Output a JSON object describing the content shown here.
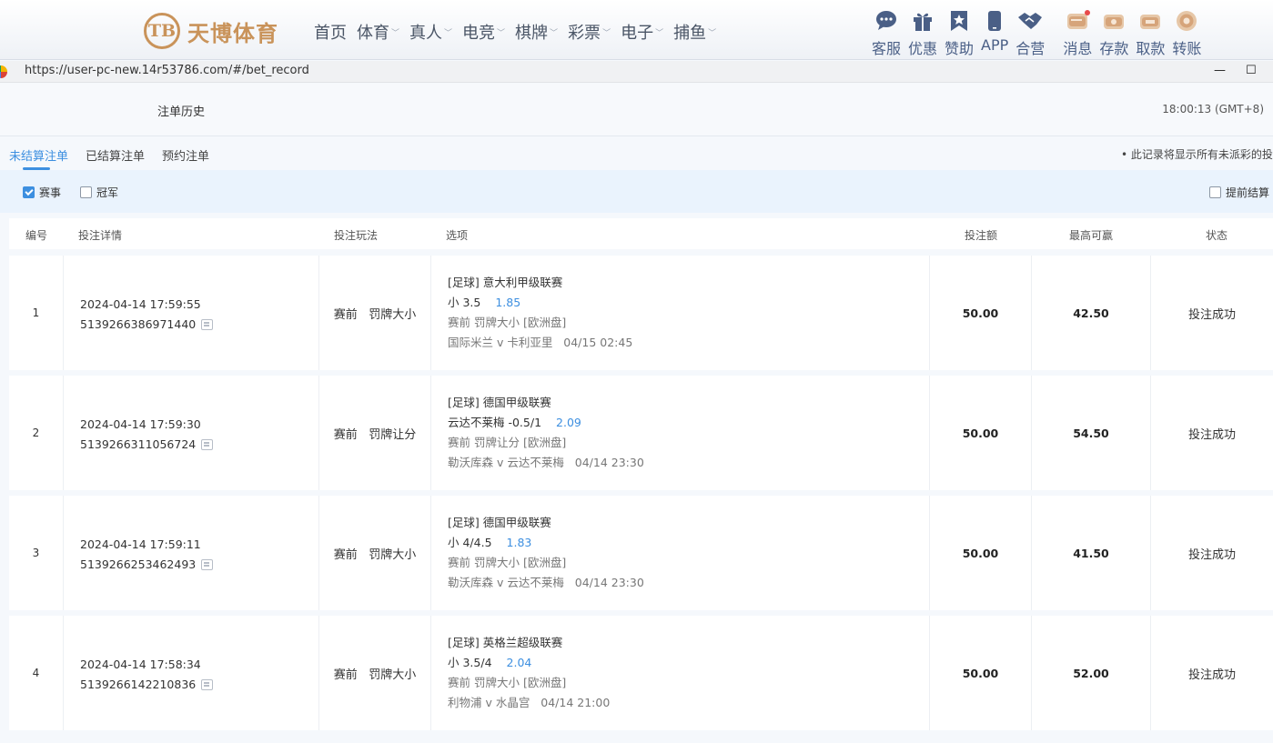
{
  "brand": {
    "logo_mark": "TB",
    "name": "天博体育"
  },
  "main_nav": [
    {
      "label": "首页",
      "has_dropdown": false
    },
    {
      "label": "体育",
      "has_dropdown": true
    },
    {
      "label": "真人",
      "has_dropdown": true
    },
    {
      "label": "电竞",
      "has_dropdown": true
    },
    {
      "label": "棋牌",
      "has_dropdown": true
    },
    {
      "label": "彩票",
      "has_dropdown": true
    },
    {
      "label": "电子",
      "has_dropdown": true
    },
    {
      "label": "捕鱼",
      "has_dropdown": true
    }
  ],
  "right_nav": [
    {
      "label": "客服",
      "icon": "chat-bubble-icon"
    },
    {
      "label": "优惠",
      "icon": "gift-icon"
    },
    {
      "label": "赞助",
      "icon": "bookmark-star-icon"
    },
    {
      "label": "APP",
      "icon": "phone-icon"
    },
    {
      "label": "合营",
      "icon": "handshake-icon"
    },
    {
      "label": "消息",
      "icon": "message-icon",
      "badge": true
    },
    {
      "label": "存款",
      "icon": "deposit-icon"
    },
    {
      "label": "取款",
      "icon": "withdraw-icon"
    },
    {
      "label": "转账",
      "icon": "transfer-icon"
    }
  ],
  "browser": {
    "url": "https://user-pc-new.14r53786.com/#/bet_record",
    "minimize": "—",
    "maximize": "☐"
  },
  "page": {
    "title": "注单历史",
    "clock": "18:00:13 (GMT+8)"
  },
  "tabs": [
    {
      "label": "未结算注单",
      "active": true
    },
    {
      "label": "已结算注单",
      "active": false
    },
    {
      "label": "预约注单",
      "active": false
    }
  ],
  "notice": "• 此记录将显示所有未派彩的投",
  "filters": {
    "event": {
      "label": "赛事",
      "checked": true
    },
    "champion": {
      "label": "冠军",
      "checked": false
    },
    "early_settle": {
      "label": "提前结算",
      "checked": false
    }
  },
  "table": {
    "headers": {
      "no": "编号",
      "detail": "投注详情",
      "play": "投注玩法",
      "selection": "选项",
      "amount": "投注额",
      "max_win": "最高可赢",
      "status": "状态"
    },
    "rows": [
      {
        "no": "1",
        "time": "2024-04-14 17:59:55",
        "order_id": "5139266386971440",
        "play": "赛前   罚牌大小",
        "league": "[足球] 意大利甲级联赛",
        "pick": "小 3.5",
        "odds": "1.85",
        "market": "赛前 罚牌大小 [欧洲盘]",
        "match": "国际米兰 v 卡利亚里",
        "match_time": "04/15 02:45",
        "amount": "50.00",
        "max_win": "42.50",
        "status": "投注成功"
      },
      {
        "no": "2",
        "time": "2024-04-14 17:59:30",
        "order_id": "5139266311056724",
        "play": "赛前   罚牌让分",
        "league": "[足球] 德国甲级联赛",
        "pick": "云达不莱梅 -0.5/1",
        "odds": "2.09",
        "market": "赛前 罚牌让分 [欧洲盘]",
        "match": "勒沃库森 v 云达不莱梅",
        "match_time": "04/14 23:30",
        "amount": "50.00",
        "max_win": "54.50",
        "status": "投注成功"
      },
      {
        "no": "3",
        "time": "2024-04-14 17:59:11",
        "order_id": "5139266253462493",
        "play": "赛前   罚牌大小",
        "league": "[足球] 德国甲级联赛",
        "pick": "小 4/4.5",
        "odds": "1.83",
        "market": "赛前 罚牌大小 [欧洲盘]",
        "match": "勒沃库森 v 云达不莱梅",
        "match_time": "04/14 23:30",
        "amount": "50.00",
        "max_win": "41.50",
        "status": "投注成功"
      },
      {
        "no": "4",
        "time": "2024-04-14 17:58:34",
        "order_id": "5139266142210836",
        "play": "赛前   罚牌大小",
        "league": "[足球] 英格兰超级联赛",
        "pick": "小 3.5/4",
        "odds": "2.04",
        "market": "赛前 罚牌大小 [欧洲盘]",
        "match": "利物浦 v 水晶宫",
        "match_time": "04/14 21:00",
        "amount": "50.00",
        "max_win": "52.00",
        "status": "投注成功"
      }
    ]
  },
  "colors": {
    "accent": "#3d8fe0",
    "brand_gold": "#c9935a",
    "nav_icon": "#4a5f86",
    "badge_red": "#e84a4a"
  }
}
